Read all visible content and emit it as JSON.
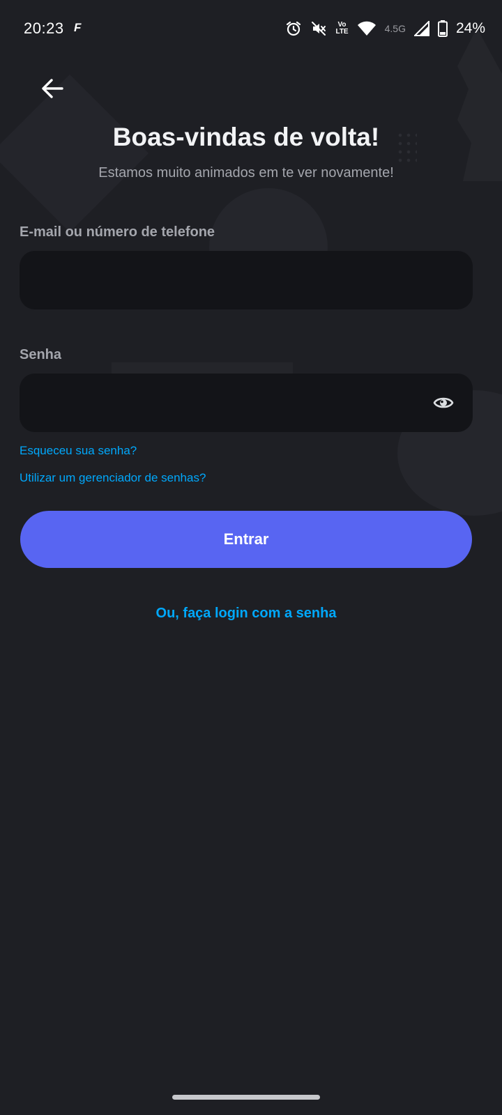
{
  "status_bar": {
    "time": "20:23",
    "app_icon_glyph": "F",
    "volte_top": "Vo",
    "volte_bottom": "LTE",
    "network_type": "4.5G",
    "battery_percent": "24%",
    "icons": [
      "alarm-icon",
      "mute-icon",
      "volte-icon",
      "wifi-icon",
      "signal-icon",
      "battery-icon"
    ]
  },
  "header": {
    "back_icon": "arrow-left-icon",
    "title": "Boas-vindas de volta!",
    "subtitle": "Estamos muito animados em te ver novamente!"
  },
  "form": {
    "email_label": "E-mail ou número de telefone",
    "email_value": "",
    "password_label": "Senha",
    "password_value": "",
    "eye_icon": "eye-icon",
    "forgot_password": "Esqueceu sua senha?",
    "password_manager": "Utilizar um gerenciador de senhas?",
    "submit_label": "Entrar",
    "alt_login": "Ou, faça login com a senha"
  },
  "colors": {
    "background": "#1e1f24",
    "input_background": "#131418",
    "accent": "#5865f2",
    "link": "#00a8fc",
    "muted_text": "#a4a6ad"
  }
}
